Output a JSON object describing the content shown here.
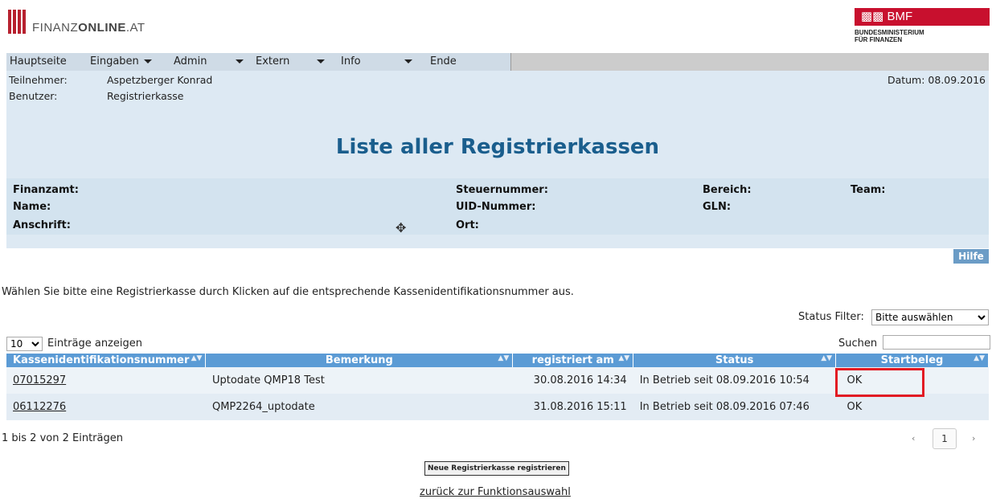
{
  "header": {
    "logo_prefix": "FINANZ",
    "logo_bold": "ONLINE",
    "logo_suffix": ".AT",
    "bmf_badge": "BMF",
    "bmf_line1": "BUNDESMINISTERIUM",
    "bmf_line2": "FÜR FINANZEN",
    "colors": {
      "logo_red": "#b7212f",
      "bmf_red": "#c8102e"
    }
  },
  "menu": {
    "items": [
      {
        "label": "Hauptseite"
      },
      {
        "label": "Eingaben"
      },
      {
        "label": "Admin"
      },
      {
        "label": "Extern"
      },
      {
        "label": "Info"
      },
      {
        "label": "Ende"
      }
    ]
  },
  "user": {
    "teilnehmer_label": "Teilnehmer:",
    "teilnehmer_value": "Aspetzberger Konrad",
    "benutzer_label": "Benutzer:",
    "benutzer_value": "Registrierkasse",
    "datum": "Datum: 08.09.2016"
  },
  "page": {
    "title": "Liste aller Registrierkassen",
    "title_color": "#1a5e8d"
  },
  "fields": {
    "finanzamt": "Finanzamt:",
    "name": "Name:",
    "anschrift": "Anschrift:",
    "steuernummer": "Steuernummer:",
    "uid": "UID-Nummer:",
    "ort": "Ort:",
    "bereich": "Bereich:",
    "gln": "GLN:",
    "team": "Team:"
  },
  "help_label": "Hilfe",
  "instruction": "Wählen Sie bitte eine Registrierkasse durch Klicken auf die entsprechende Kassenidentifikationsnummer aus.",
  "status_filter": {
    "label": "Status Filter:",
    "selected": "Bitte auswählen"
  },
  "entries": {
    "selected": "10",
    "label": "Einträge anzeigen"
  },
  "search": {
    "label": "Suchen",
    "value": ""
  },
  "table": {
    "headers": [
      "Kassenidentifikationsnummer",
      "Bemerkung",
      "registriert am",
      "Status",
      "Startbeleg"
    ],
    "header_color": "#5b9bd5",
    "rows": [
      {
        "id": "07015297",
        "bemerkung": "Uptodate QMP18 Test",
        "registriert": "30.08.2016 14:34",
        "status": "In Betrieb seit 08.09.2016 10:54",
        "startbeleg": "OK"
      },
      {
        "id": "06112276",
        "bemerkung": "QMP2264_uptodate",
        "registriert": "31.08.2016 15:11",
        "status": "In Betrieb seit 08.09.2016 07:46",
        "startbeleg": "OK"
      }
    ]
  },
  "pagination": {
    "info": "1 bis 2 von 2 Einträgen",
    "prev": "‹",
    "page": "1",
    "next": "›"
  },
  "new_button": "Neue Registrierkasse registrieren",
  "back_link": "zurück zur Funktionsauswahl"
}
